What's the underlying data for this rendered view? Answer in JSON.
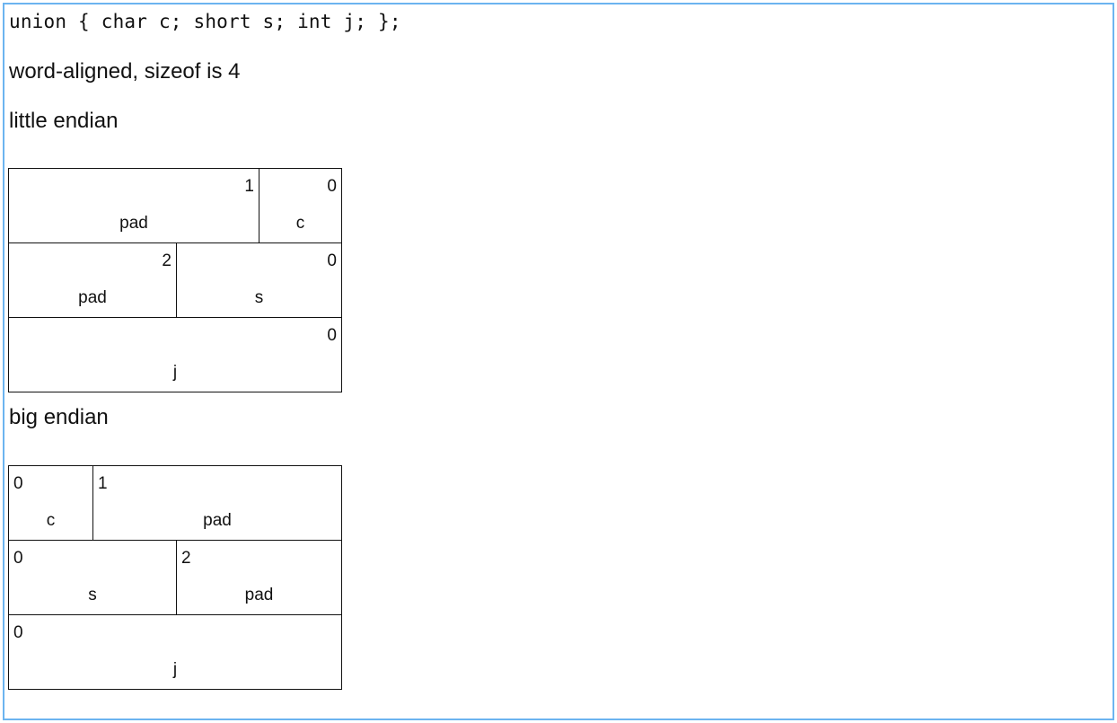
{
  "code": "union { char c; short s; int j; };",
  "note": "word-aligned, sizeof is 4",
  "little_endian": {
    "heading": "little endian",
    "rows": [
      [
        {
          "index": "1",
          "name": "pad"
        },
        {
          "index": "0",
          "name": "c"
        }
      ],
      [
        {
          "index": "2",
          "name": "pad"
        },
        {
          "index": "0",
          "name": "s"
        }
      ],
      [
        {
          "index": "0",
          "name": "j"
        }
      ]
    ]
  },
  "big_endian": {
    "heading": "big endian",
    "rows": [
      [
        {
          "index": "0",
          "name": "c"
        },
        {
          "index": "1",
          "name": "pad"
        }
      ],
      [
        {
          "index": "0",
          "name": "s"
        },
        {
          "index": "2",
          "name": "pad"
        }
      ],
      [
        {
          "index": "0",
          "name": "j"
        }
      ]
    ]
  }
}
